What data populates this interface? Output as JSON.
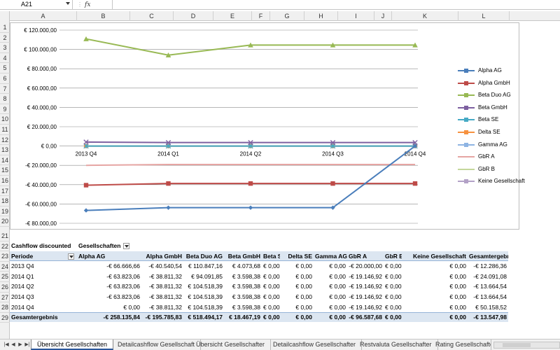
{
  "name_box": "A21",
  "fx_label": "fx",
  "columns": [
    "A",
    "B",
    "C",
    "D",
    "E",
    "F",
    "G",
    "H",
    "I",
    "J",
    "K",
    "L"
  ],
  "rows": [
    "1",
    "2",
    "3",
    "4",
    "5",
    "6",
    "7",
    "8",
    "9",
    "10",
    "11",
    "12",
    "13",
    "14",
    "15",
    "16",
    "17",
    "18",
    "19",
    "20",
    "21",
    "22",
    "23",
    "24",
    "25",
    "26",
    "27",
    "28",
    "29"
  ],
  "chart_data": {
    "type": "line",
    "categories": [
      "2013 Q4",
      "2014 Q1",
      "2014 Q2",
      "2014 Q3",
      "2014 Q4"
    ],
    "ylim": [
      -80000,
      120000
    ],
    "yticks": [
      "€ 120.000,00",
      "€ 100.000,00",
      "€ 80.000,00",
      "€ 60.000,00",
      "€ 40.000,00",
      "€ 20.000,00",
      "€ 0,00",
      "-€ 20.000,00",
      "-€ 40.000,00",
      "-€ 60.000,00",
      "-€ 80.000,00"
    ],
    "grid": true,
    "legend_position": "right",
    "series": [
      {
        "name": "Alpha AG",
        "color": "#4a7ebb",
        "marker": "diamond",
        "values": [
          -66666.66,
          -63823.06,
          -63823.06,
          -63823.06,
          0
        ]
      },
      {
        "name": "Alpha GmbH",
        "color": "#be4b48",
        "marker": "square",
        "values": [
          -40540.54,
          -38811.32,
          -38811.32,
          -38811.32,
          -38811.32
        ]
      },
      {
        "name": "Beta Duo AG",
        "color": "#98b954",
        "marker": "triangle",
        "values": [
          110847.16,
          94091.85,
          104518.39,
          104518.39,
          104518.39
        ]
      },
      {
        "name": "Beta GmbH",
        "color": "#7d60a0",
        "marker": "x",
        "values": [
          4073.68,
          3598.38,
          3598.38,
          3598.38,
          3598.38
        ]
      },
      {
        "name": "Beta SE",
        "color": "#46aac5",
        "marker": "star",
        "values": [
          0,
          0,
          0,
          0,
          0
        ]
      },
      {
        "name": "Delta SE",
        "color": "#f69240",
        "marker": "circle",
        "values": [
          0,
          0,
          0,
          0,
          0
        ]
      },
      {
        "name": "Gamma AG",
        "color": "#8eb4e3",
        "marker": "plus",
        "values": [
          0,
          0,
          0,
          0,
          0
        ]
      },
      {
        "name": "GbR A",
        "color": "#e6a5a3",
        "marker": "none",
        "values": [
          -20000,
          -19146.92,
          -19146.92,
          -19146.92,
          -19146.92
        ]
      },
      {
        "name": "GbR B",
        "color": "#c4d79b",
        "marker": "none",
        "values": [
          0,
          0,
          0,
          0,
          0
        ]
      },
      {
        "name": "Keine Gesellschaft",
        "color": "#b3a2c7",
        "marker": "x",
        "values": [
          0,
          0,
          0,
          0,
          0
        ]
      }
    ]
  },
  "pivot": {
    "title": "Cashflow discounted",
    "col_field": "Gesellschaften",
    "row_field": "Periode",
    "headers": [
      "Alpha AG",
      "Alpha GmbH",
      "Beta Duo AG",
      "Beta GmbH",
      "Beta SE",
      "Delta SE",
      "Gamma AG",
      "GbR A",
      "GbR B",
      "Keine Gesellschaft",
      "Gesamtergebnis"
    ],
    "rows": [
      {
        "label": "2013 Q4",
        "values": [
          "-€ 66.666,66",
          "-€ 40.540,54",
          "€ 110.847,16",
          "€ 4.073,68",
          "€ 0,00",
          "€ 0,00",
          "€ 0,00",
          "-€ 20.000,00",
          "€ 0,00",
          "€ 0,00",
          "-€ 12.286,36"
        ]
      },
      {
        "label": "2014 Q1",
        "values": [
          "-€ 63.823,06",
          "-€ 38.811,32",
          "€ 94.091,85",
          "€ 3.598,38",
          "€ 0,00",
          "€ 0,00",
          "€ 0,00",
          "-€ 19.146,92",
          "€ 0,00",
          "€ 0,00",
          "-€ 24.091,08"
        ]
      },
      {
        "label": "2014 Q2",
        "values": [
          "-€ 63.823,06",
          "-€ 38.811,32",
          "€ 104.518,39",
          "€ 3.598,38",
          "€ 0,00",
          "€ 0,00",
          "€ 0,00",
          "-€ 19.146,92",
          "€ 0,00",
          "€ 0,00",
          "-€ 13.664,54"
        ]
      },
      {
        "label": "2014 Q3",
        "values": [
          "-€ 63.823,06",
          "-€ 38.811,32",
          "€ 104.518,39",
          "€ 3.598,38",
          "€ 0,00",
          "€ 0,00",
          "€ 0,00",
          "-€ 19.146,92",
          "€ 0,00",
          "€ 0,00",
          "-€ 13.664,54"
        ]
      },
      {
        "label": "2014 Q4",
        "values": [
          "€ 0,00",
          "-€ 38.811,32",
          "€ 104.518,39",
          "€ 3.598,38",
          "€ 0,00",
          "€ 0,00",
          "€ 0,00",
          "-€ 19.146,92",
          "€ 0,00",
          "€ 0,00",
          "€ 50.158,52"
        ]
      }
    ],
    "total": {
      "label": "Gesamtergebnis",
      "values": [
        "-€ 258.135,84",
        "-€ 195.785,83",
        "€ 518.494,17",
        "€ 18.467,19",
        "€ 0,00",
        "€ 0,00",
        "€ 0,00",
        "-€ 96.587,68",
        "€ 0,00",
        "€ 0,00",
        "-€ 13.547,98"
      ]
    }
  },
  "sheet_tabs": [
    "Übersicht Gesellschaften",
    "Detailcashflow Gesellschaft",
    "Übersicht Gesellschafter",
    "Detailcashflow Gesellschafter",
    "Restvaluta Gesellschafter",
    "Rating Gesellschafte"
  ],
  "active_tab": "Übersicht Gesellschaften",
  "nav_buttons": [
    "|◀",
    "◀",
    "▶",
    "▶|"
  ]
}
